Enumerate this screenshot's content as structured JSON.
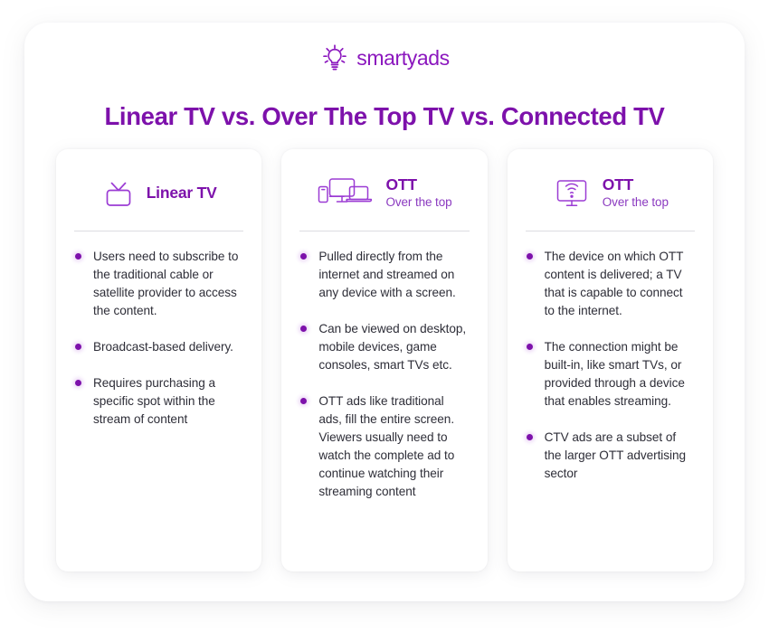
{
  "brand": {
    "name": "smartyads",
    "logo_icon": "lightbulb-icon",
    "accent_color": "#7D11AB",
    "logo_color": "#8B17BE"
  },
  "header": {
    "title": "Linear TV vs. Over The Top TV vs. Connected TV"
  },
  "cards": [
    {
      "icon": "retro-tv-icon",
      "title": "Linear TV",
      "subtitle": "",
      "bullets": [
        "Users need to subscribe to the traditional cable or satellite provider to access the content.",
        "Broadcast-based delivery.",
        "Requires purchasing a specific spot within the stream of content"
      ]
    },
    {
      "icon": "multi-device-icon",
      "title": "OTT",
      "subtitle": "Over the top",
      "bullets": [
        "Pulled directly from the internet and streamed on any device with a screen.",
        "Can be viewed on desktop, mobile devices, game consoles, smart TVs etc.",
        "OTT ads like traditional ads, fill the entire screen. Viewers usually need to watch the complete ad to continue watching their streaming content"
      ]
    },
    {
      "icon": "wifi-tv-icon",
      "title": "OTT",
      "subtitle": "Over the top",
      "bullets": [
        "The device on which OTT content is delivered; a TV that is capable to connect to the internet.",
        "The connection might be built-in, like smart TVs, or provided through a device that enables streaming.",
        "CTV ads are a subset of the larger OTT advertising sector"
      ]
    }
  ]
}
